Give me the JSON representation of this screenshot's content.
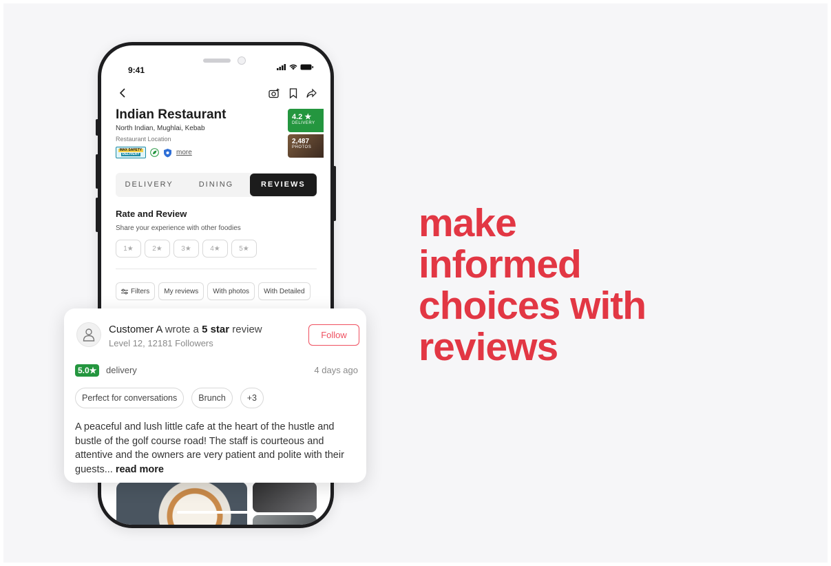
{
  "status_bar": {
    "time": "9:41"
  },
  "restaurant": {
    "name": "Indian Restaurant",
    "cuisine": "North Indian, Mughlai, Kebab",
    "location": "Restaurant Location",
    "badge_line1": "MAX SAFETY",
    "badge_line2": "DELIVERY",
    "more_label": "more",
    "rating_value": "4.2 ★",
    "rating_label": "DELIVERY",
    "photos_count": "2,487",
    "photos_label": "PHOTOS"
  },
  "tabs": [
    {
      "label": "DELIVERY",
      "active": false
    },
    {
      "label": "DINING",
      "active": false
    },
    {
      "label": "REVIEWS",
      "active": true
    }
  ],
  "rate_review": {
    "title": "Rate and Review",
    "subtitle": "Share your experience with other foodies",
    "star_options": [
      "1★",
      "2★",
      "3★",
      "4★",
      "5★"
    ]
  },
  "filters": {
    "filters_label": "Filters",
    "chips": [
      "My reviews",
      "With photos",
      "With Detailed"
    ]
  },
  "review_card": {
    "name": "Customer A",
    "wrote": " wrote a ",
    "stars_text": "5 star",
    "suffix": " review",
    "level": "Level 12, 12181 Followers",
    "follow_label": "Follow",
    "rating": "5.0★",
    "rating_type": "delivery",
    "date": "4 days ago",
    "tags": [
      "Perfect for conversations",
      "Brunch"
    ],
    "more_tags": "+3",
    "text": "A peaceful and lush little cafe at the heart of the hustle and bustle of the golf course road! The staff is courteous and attentive and the owners are very patient and polite with their guests... ",
    "read_more": "read more"
  },
  "headline": {
    "line1": "make",
    "line2": "informed",
    "line3": "choices with",
    "line4": "reviews"
  },
  "colors": {
    "brand_red": "#e23744",
    "rating_green": "#24963f",
    "follow_red": "#ef4f5f",
    "dark": "#1c1c1c"
  }
}
